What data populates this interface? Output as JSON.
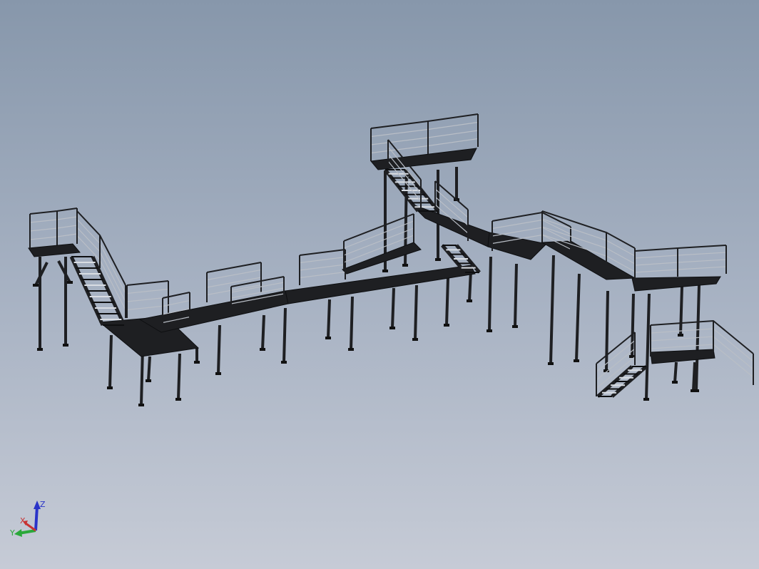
{
  "viewport": {
    "background_top": "#8797ab",
    "background_bottom": "#c6cbd6",
    "model_color": "#1e1f22",
    "rail_color": "#b9bec6"
  },
  "triad": {
    "z_label": "Z",
    "x_label": "X",
    "y_label": "Y",
    "z_color": "#2a34c8",
    "x_color": "#c83232",
    "y_color": "#2aa83a"
  }
}
